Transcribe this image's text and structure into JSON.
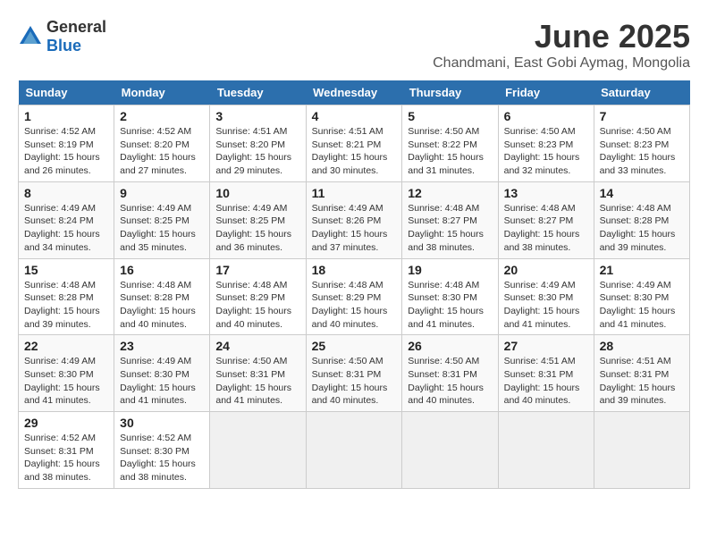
{
  "logo": {
    "general": "General",
    "blue": "Blue"
  },
  "title": "June 2025",
  "location": "Chandmani, East Gobi Aymag, Mongolia",
  "headers": [
    "Sunday",
    "Monday",
    "Tuesday",
    "Wednesday",
    "Thursday",
    "Friday",
    "Saturday"
  ],
  "weeks": [
    [
      {
        "day": "1",
        "sunrise": "4:52 AM",
        "sunset": "8:19 PM",
        "daylight": "15 hours and 26 minutes."
      },
      {
        "day": "2",
        "sunrise": "4:52 AM",
        "sunset": "8:20 PM",
        "daylight": "15 hours and 27 minutes."
      },
      {
        "day": "3",
        "sunrise": "4:51 AM",
        "sunset": "8:20 PM",
        "daylight": "15 hours and 29 minutes."
      },
      {
        "day": "4",
        "sunrise": "4:51 AM",
        "sunset": "8:21 PM",
        "daylight": "15 hours and 30 minutes."
      },
      {
        "day": "5",
        "sunrise": "4:50 AM",
        "sunset": "8:22 PM",
        "daylight": "15 hours and 31 minutes."
      },
      {
        "day": "6",
        "sunrise": "4:50 AM",
        "sunset": "8:23 PM",
        "daylight": "15 hours and 32 minutes."
      },
      {
        "day": "7",
        "sunrise": "4:50 AM",
        "sunset": "8:23 PM",
        "daylight": "15 hours and 33 minutes."
      }
    ],
    [
      {
        "day": "8",
        "sunrise": "4:49 AM",
        "sunset": "8:24 PM",
        "daylight": "15 hours and 34 minutes."
      },
      {
        "day": "9",
        "sunrise": "4:49 AM",
        "sunset": "8:25 PM",
        "daylight": "15 hours and 35 minutes."
      },
      {
        "day": "10",
        "sunrise": "4:49 AM",
        "sunset": "8:25 PM",
        "daylight": "15 hours and 36 minutes."
      },
      {
        "day": "11",
        "sunrise": "4:49 AM",
        "sunset": "8:26 PM",
        "daylight": "15 hours and 37 minutes."
      },
      {
        "day": "12",
        "sunrise": "4:48 AM",
        "sunset": "8:27 PM",
        "daylight": "15 hours and 38 minutes."
      },
      {
        "day": "13",
        "sunrise": "4:48 AM",
        "sunset": "8:27 PM",
        "daylight": "15 hours and 38 minutes."
      },
      {
        "day": "14",
        "sunrise": "4:48 AM",
        "sunset": "8:28 PM",
        "daylight": "15 hours and 39 minutes."
      }
    ],
    [
      {
        "day": "15",
        "sunrise": "4:48 AM",
        "sunset": "8:28 PM",
        "daylight": "15 hours and 39 minutes."
      },
      {
        "day": "16",
        "sunrise": "4:48 AM",
        "sunset": "8:28 PM",
        "daylight": "15 hours and 40 minutes."
      },
      {
        "day": "17",
        "sunrise": "4:48 AM",
        "sunset": "8:29 PM",
        "daylight": "15 hours and 40 minutes."
      },
      {
        "day": "18",
        "sunrise": "4:48 AM",
        "sunset": "8:29 PM",
        "daylight": "15 hours and 40 minutes."
      },
      {
        "day": "19",
        "sunrise": "4:48 AM",
        "sunset": "8:30 PM",
        "daylight": "15 hours and 41 minutes."
      },
      {
        "day": "20",
        "sunrise": "4:49 AM",
        "sunset": "8:30 PM",
        "daylight": "15 hours and 41 minutes."
      },
      {
        "day": "21",
        "sunrise": "4:49 AM",
        "sunset": "8:30 PM",
        "daylight": "15 hours and 41 minutes."
      }
    ],
    [
      {
        "day": "22",
        "sunrise": "4:49 AM",
        "sunset": "8:30 PM",
        "daylight": "15 hours and 41 minutes."
      },
      {
        "day": "23",
        "sunrise": "4:49 AM",
        "sunset": "8:30 PM",
        "daylight": "15 hours and 41 minutes."
      },
      {
        "day": "24",
        "sunrise": "4:50 AM",
        "sunset": "8:31 PM",
        "daylight": "15 hours and 41 minutes."
      },
      {
        "day": "25",
        "sunrise": "4:50 AM",
        "sunset": "8:31 PM",
        "daylight": "15 hours and 40 minutes."
      },
      {
        "day": "26",
        "sunrise": "4:50 AM",
        "sunset": "8:31 PM",
        "daylight": "15 hours and 40 minutes."
      },
      {
        "day": "27",
        "sunrise": "4:51 AM",
        "sunset": "8:31 PM",
        "daylight": "15 hours and 40 minutes."
      },
      {
        "day": "28",
        "sunrise": "4:51 AM",
        "sunset": "8:31 PM",
        "daylight": "15 hours and 39 minutes."
      }
    ],
    [
      {
        "day": "29",
        "sunrise": "4:52 AM",
        "sunset": "8:31 PM",
        "daylight": "15 hours and 38 minutes."
      },
      {
        "day": "30",
        "sunrise": "4:52 AM",
        "sunset": "8:30 PM",
        "daylight": "15 hours and 38 minutes."
      },
      null,
      null,
      null,
      null,
      null
    ]
  ]
}
